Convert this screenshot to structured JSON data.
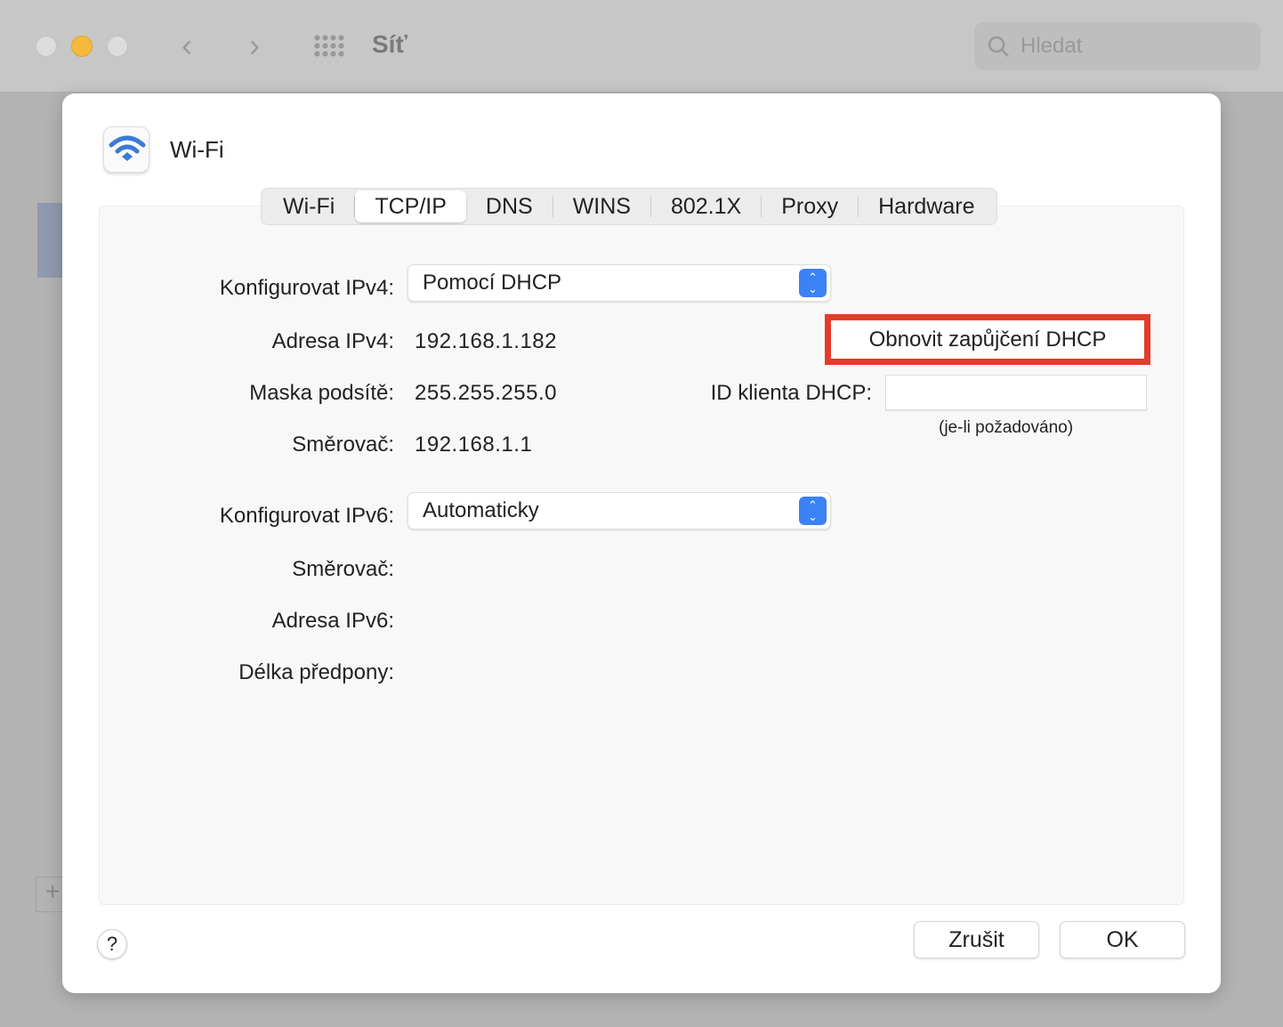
{
  "window": {
    "title": "Síť",
    "search_placeholder": "Hledat"
  },
  "sheet": {
    "title": "Wi-Fi",
    "tabs": [
      "Wi-Fi",
      "TCP/IP",
      "DNS",
      "WINS",
      "802.1X",
      "Proxy",
      "Hardware"
    ],
    "active_tab": "TCP/IP",
    "ipv4": {
      "config_label": "Konfigurovat IPv4:",
      "config_value": "Pomocí DHCP",
      "address_label": "Adresa IPv4:",
      "address": "192.168.1.182",
      "mask_label": "Maska podsítě:",
      "mask": "255.255.255.0",
      "router_label": "Směrovač:",
      "router": "192.168.1.1"
    },
    "renew_button": "Obnovit zapůjčení DHCP",
    "client_id_label": "ID klienta DHCP:",
    "client_id_value": "",
    "client_id_hint": "(je-li požadováno)",
    "ipv6": {
      "config_label": "Konfigurovat IPv6:",
      "config_value": "Automaticky",
      "router_label": "Směrovač:",
      "address_label": "Adresa IPv6:",
      "prefix_label": "Délka předpony:"
    },
    "help": "?",
    "cancel": "Zrušit",
    "ok": "OK"
  },
  "colors": {
    "highlight": "#e63b2a",
    "accent": "#3b82f6"
  }
}
